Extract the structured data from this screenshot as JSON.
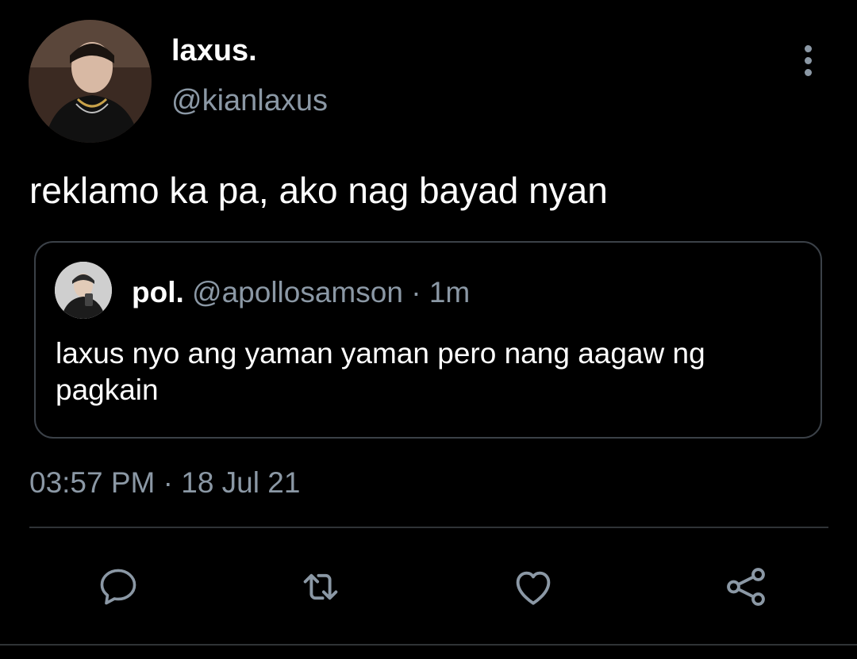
{
  "tweet": {
    "author": {
      "display_name": "laxus.",
      "handle": "@kianlaxus",
      "avatar_icon": "profile-photo"
    },
    "text": "reklamo ka pa, ako nag bayad nyan",
    "quoted": {
      "display_name": "pol.",
      "handle": "@apollosamson",
      "separator": " · ",
      "time": "1m",
      "text": "laxus nyo ang yaman yaman pero nang aagaw ng pagkain",
      "avatar_icon": "profile-photo"
    },
    "timestamp": "03:57 PM · 18 Jul 21"
  },
  "actions": [
    {
      "name": "reply",
      "icon": "speech-bubble-icon"
    },
    {
      "name": "retweet",
      "icon": "retweet-icon"
    },
    {
      "name": "like",
      "icon": "heart-icon"
    },
    {
      "name": "share",
      "icon": "share-icon"
    }
  ],
  "colors": {
    "background": "#000000",
    "text_primary": "#ffffff",
    "text_secondary": "#8b98a5",
    "border": "#3b4148"
  }
}
